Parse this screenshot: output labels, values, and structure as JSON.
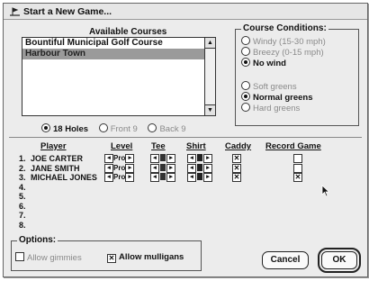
{
  "window": {
    "title": "Start a New Game..."
  },
  "courses": {
    "heading": "Available Courses",
    "items": [
      "Bountiful Municipal Golf Course",
      "Harbour Town"
    ],
    "selected_index": 1
  },
  "holes": {
    "options": [
      "18 Holes",
      "Front 9",
      "Back 9"
    ],
    "selected_index": 0
  },
  "conditions": {
    "heading": "Course Conditions:",
    "wind": [
      "Windy (15-30 mph)",
      "Breezy (0-15 mph)",
      "No wind"
    ],
    "wind_selected": 2,
    "greens": [
      "Soft greens",
      "Normal greens",
      "Hard greens"
    ],
    "greens_selected": 1
  },
  "players": {
    "columns": {
      "player": "Player",
      "level": "Level",
      "tee": "Tee",
      "shirt": "Shirt",
      "caddy": "Caddy",
      "record": "Record Game"
    },
    "numbers": [
      "1.",
      "2.",
      "3.",
      "4.",
      "5.",
      "6.",
      "7.",
      "8."
    ],
    "rows": [
      {
        "name": "JOE CARTER",
        "level": "Pro",
        "caddy": true,
        "record": false
      },
      {
        "name": "JANE SMITH",
        "level": "Pro",
        "caddy": true,
        "record": false
      },
      {
        "name": "MICHAEL JONES",
        "level": "Pro",
        "caddy": true,
        "record": true
      }
    ]
  },
  "options": {
    "heading": "Options:",
    "gimmies": "Allow gimmies",
    "mulligans": "Allow mulligans",
    "gimmies_checked": false,
    "mulligans_checked": true
  },
  "buttons": {
    "cancel": "Cancel",
    "ok": "OK"
  },
  "colors": {
    "selection": "#9a9a9a",
    "tee_dark": "#333333",
    "shirt_dark": "#222222"
  }
}
